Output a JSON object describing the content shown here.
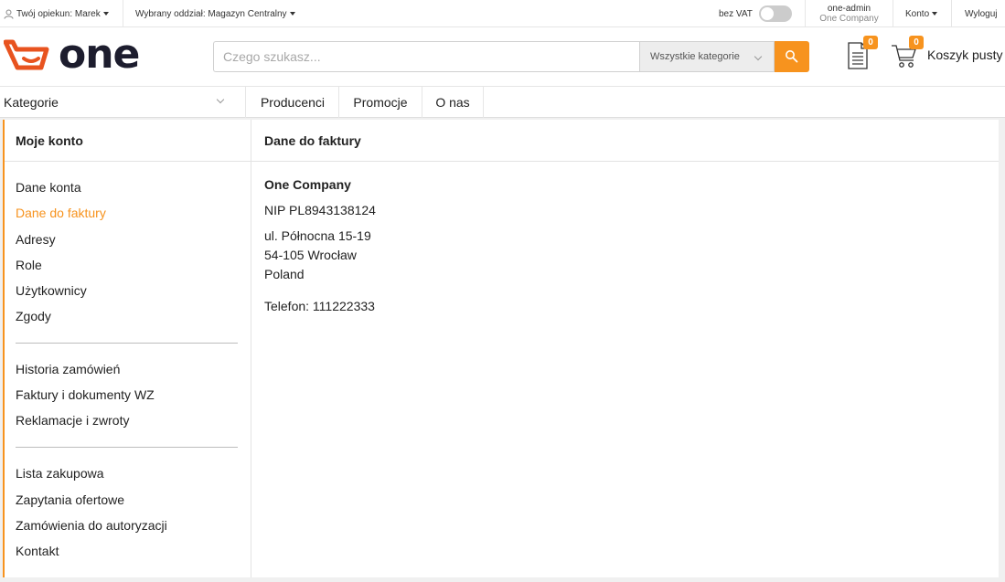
{
  "topbar": {
    "guardian_label": "Twój opiekun: Marek",
    "branch_label": "Wybrany oddział: Magazyn Centralny",
    "vat_label": "bez VAT",
    "user_login": "one-admin",
    "user_company": "One Company",
    "account_label": "Konto",
    "logout_label": "Wyloguj"
  },
  "header": {
    "logo_text": "one",
    "search_placeholder": "Czego szukasz...",
    "search_category": "Wszystkie kategorie",
    "documents_count": "0",
    "cart_count": "0",
    "cart_label": "Koszyk pusty"
  },
  "nav": {
    "categories_label": "Kategorie",
    "links": [
      "Producenci",
      "Promocje",
      "O nas"
    ]
  },
  "sidebar": {
    "title": "Moje konto",
    "group1": [
      "Dane konta",
      "Dane do faktury",
      "Adresy",
      "Role",
      "Użytkownicy",
      "Zgody"
    ],
    "group2": [
      "Historia zamówień",
      "Faktury i dokumenty WZ",
      "Reklamacje i zwroty"
    ],
    "group3": [
      "Lista zakupowa",
      "Zapytania ofertowe",
      "Zamówienia do autoryzacji",
      "Kontakt"
    ],
    "active_item": "Dane do faktury"
  },
  "main": {
    "title": "Dane do faktury",
    "company_name": "One Company",
    "nip": "NIP PL8943138124",
    "street": "ul. Północna 15-19",
    "city": "54-105 Wrocław",
    "country": "Poland",
    "phone": "Telefon: 111222333"
  },
  "colors": {
    "accent": "#f7931e",
    "logo_dark": "#1d1d2e",
    "logo_orange": "#e8531f"
  }
}
